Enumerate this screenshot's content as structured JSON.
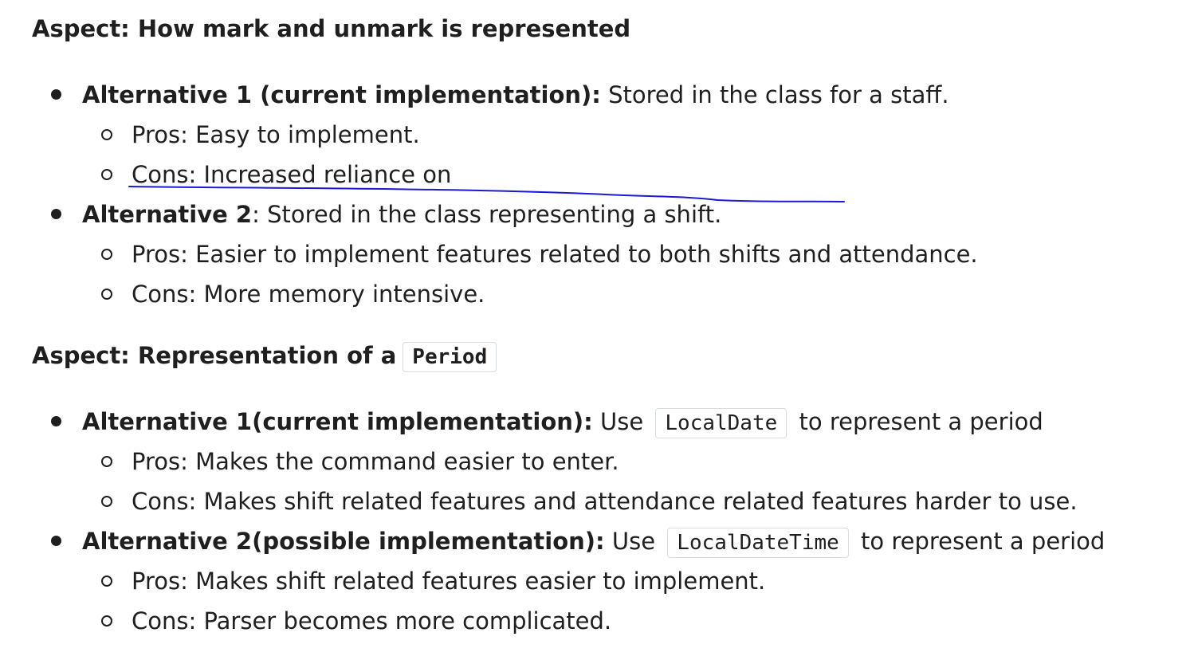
{
  "section1": {
    "heading": "Aspect: How mark and unmark is represented",
    "alt1": {
      "label": "Alternative 1 (current implementation):",
      "text": " Stored in the class for a staff.",
      "pros": "Pros: Easy to implement.",
      "cons": "Cons: Increased reliance on"
    },
    "alt2": {
      "label": "Alternative 2",
      "text": ": Stored in the class representing a shift.",
      "pros": "Pros: Easier to implement features related to both shifts and attendance.",
      "cons": "Cons: More memory intensive."
    }
  },
  "section2": {
    "heading": "Aspect: Representation of a",
    "heading_code": "Period",
    "alt1": {
      "label": "Alternative 1(current implementation):",
      "pre": " Use",
      "code": "LocalDate",
      "post": "to represent a period",
      "pros": "Pros: Makes the command easier to enter.",
      "cons": "Cons: Makes shift related features and attendance related features harder to use."
    },
    "alt2": {
      "label": "Alternative 2(possible implementation):",
      "pre": " Use",
      "code": "LocalDateTime",
      "post": "to represent a period",
      "pros": "Pros: Makes shift related features easier to implement.",
      "cons": "Cons: Parser becomes more complicated."
    }
  },
  "colors": {
    "text": "#1f1f1f",
    "ink_annotation": "#1a1ad6",
    "code_border": "#d8dde3"
  }
}
